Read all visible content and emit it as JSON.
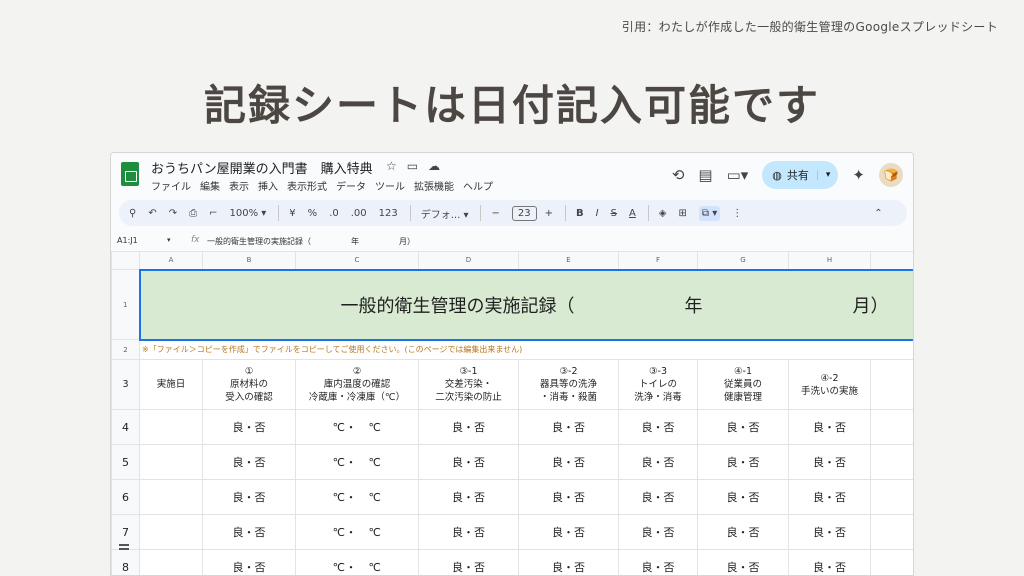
{
  "caption": "引用：わたしが作成した一般的衛生管理のGoogleスプレッドシート",
  "headline": "記録シートは日付記入可能です",
  "titlebar": {
    "doc_title": "おうちパン屋開業の入門書　購入特典",
    "menu": [
      "ファイル",
      "編集",
      "表示",
      "挿入",
      "表示形式",
      "データ",
      "ツール",
      "拡張機能",
      "ヘルプ"
    ],
    "share_label": "共有"
  },
  "toolbar": {
    "zoom": "100%",
    "currency": "¥",
    "percent": "%",
    "decrease_decimal": ".0",
    "increase_decimal": ".00",
    "number_format": "123",
    "font": "デフォ...",
    "font_size": "23",
    "bold": "B",
    "italic": "I",
    "strike": "S",
    "text_color": "A"
  },
  "formula_bar": {
    "cell_ref": "A1:J1",
    "content": "一般的衛生管理の実施記録（　　　　　年　　　　　月）"
  },
  "columns": [
    "A",
    "B",
    "C",
    "D",
    "E",
    "F",
    "G",
    "H"
  ],
  "row_numbers": [
    "1",
    "2",
    "3",
    "4",
    "5",
    "6",
    "7",
    "8"
  ],
  "sheet": {
    "title_left": "一般的衛生管理の実施記録（",
    "title_year": "年",
    "title_month": "月）",
    "notice": "※「ファイル＞コピーを作成」でファイルをコピーしてご使用ください。(このページでは編集出来ません)",
    "headers": [
      {
        "line1": "実施日",
        "line2": ""
      },
      {
        "line1": "①",
        "line2": "原材料の",
        "line3": "受入の確認"
      },
      {
        "line1": "②",
        "line2": "庫内温度の確認",
        "line3": "冷蔵庫・冷凍庫（℃）"
      },
      {
        "line1": "③-1",
        "line2": "交差汚染・",
        "line3": "二次汚染の防止"
      },
      {
        "line1": "③-2",
        "line2": "器具等の洗浄",
        "line3": "・消毒・殺菌"
      },
      {
        "line1": "③-3",
        "line2": "トイレの",
        "line3": "洗浄・消毒"
      },
      {
        "line1": "④-1",
        "line2": "従業員の",
        "line3": "健康管理"
      },
      {
        "line1": "④-2",
        "line2": "手洗いの実施",
        "line3": ""
      }
    ],
    "good_bad": "良・否",
    "temp_cell": "℃・　℃"
  },
  "colors": {
    "title_band": "#d9ead3",
    "selection": "#1a73e8",
    "notice": "#b7791f",
    "share": "#c2e7ff"
  }
}
